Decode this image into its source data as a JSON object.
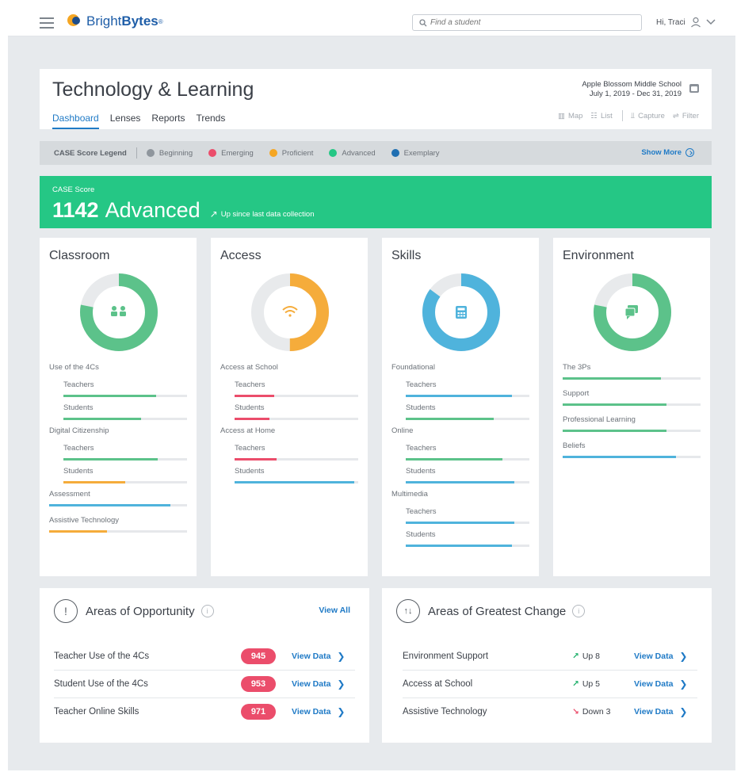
{
  "app": {
    "logo_text_light": "Bright",
    "logo_text_bold": "Bytes",
    "logo_tm": "®"
  },
  "search": {
    "placeholder": "Find a student"
  },
  "user": {
    "greeting": "Hi, Traci"
  },
  "header": {
    "title": "Technology & Learning",
    "school": "Apple Blossom Middle School",
    "date_range": "July 1, 2019 - Dec 31, 2019",
    "tabs": [
      {
        "label": "Dashboard",
        "active": true
      },
      {
        "label": "Lenses",
        "active": false
      },
      {
        "label": "Reports",
        "active": false
      },
      {
        "label": "Trends",
        "active": false
      }
    ],
    "tools": {
      "map": "Map",
      "list": "List",
      "capture": "Capture",
      "filter": "Filter"
    }
  },
  "legend": {
    "title": "CASE Score Legend",
    "items": [
      {
        "label": "Beginning",
        "color": "#8f969d"
      },
      {
        "label": "Emerging",
        "color": "#eb4d6b"
      },
      {
        "label": "Proficient",
        "color": "#f5a623"
      },
      {
        "label": "Advanced",
        "color": "#25c785"
      },
      {
        "label": "Exemplary",
        "color": "#1f6fb2"
      }
    ],
    "show_more": "Show More"
  },
  "case_score": {
    "label": "CASE Score",
    "value": "1142",
    "level": "Advanced",
    "trend": "Up since last data collection",
    "color": "#25c785"
  },
  "cards": {
    "classroom": {
      "title": "Classroom",
      "donut_fraction": 0.78,
      "color": "#5cc28a",
      "sections": {
        "s1": {
          "label": "Use of the 4Cs",
          "teachers": "Teachers",
          "students": "Students"
        },
        "s2": {
          "label": "Digital Citizenship",
          "teachers": "Teachers",
          "students": "Students"
        },
        "assessment": "Assessment",
        "assistive": "Assistive Technology"
      }
    },
    "access": {
      "title": "Access",
      "donut_fraction": 0.5,
      "color": "#f5ac3b",
      "sections": {
        "s1": {
          "label": "Access at School",
          "teachers": "Teachers",
          "students": "Students"
        },
        "s2": {
          "label": "Access at Home",
          "teachers": "Teachers",
          "students": "Students"
        }
      }
    },
    "skills": {
      "title": "Skills",
      "donut_fraction": 0.85,
      "color": "#4fb3dc",
      "sections": {
        "s1": {
          "label": "Foundational",
          "teachers": "Teachers",
          "students": "Students"
        },
        "s2": {
          "label": "Online",
          "teachers": "Teachers",
          "students": "Students"
        },
        "s3": {
          "label": "Multimedia",
          "teachers": "Teachers",
          "students": "Students"
        }
      }
    },
    "environment": {
      "title": "Environment",
      "donut_fraction": 0.78,
      "color": "#5cc28a",
      "sections": {
        "p1": "The 3Ps",
        "p2": "Support",
        "p3": "Professional Learning",
        "p4": "Beliefs"
      }
    }
  },
  "bar_levels": {
    "classroom": [
      0.75,
      0.63,
      0.76,
      0.5,
      0.88,
      0.42
    ],
    "access": [
      0.32,
      0.28,
      0.34,
      0.97
    ],
    "skills": [
      0.86,
      0.71,
      0.78,
      0.88,
      0.88,
      0.86
    ],
    "environment": [
      0.71,
      0.75,
      0.75,
      0.82
    ]
  },
  "opportunity": {
    "title": "Areas of Opportunity",
    "view_all": "View All",
    "rows": [
      {
        "label": "Teacher Use of the 4Cs",
        "score": "945",
        "action": "View Data"
      },
      {
        "label": "Student Use of the 4Cs",
        "score": "953",
        "action": "View Data"
      },
      {
        "label": "Teacher Online Skills",
        "score": "971",
        "action": "View Data"
      }
    ]
  },
  "change": {
    "title": "Areas of Greatest Change",
    "rows": [
      {
        "label": "Environment Support",
        "direction": "up",
        "arrow": "↗",
        "change": "Up 8",
        "action": "View Data"
      },
      {
        "label": "Access at School",
        "direction": "up",
        "arrow": "↗",
        "change": "Up 5",
        "action": "View Data"
      },
      {
        "label": "Assistive Technology",
        "direction": "down",
        "arrow": "↘",
        "change": "Down 3",
        "action": "View Data"
      }
    ]
  }
}
